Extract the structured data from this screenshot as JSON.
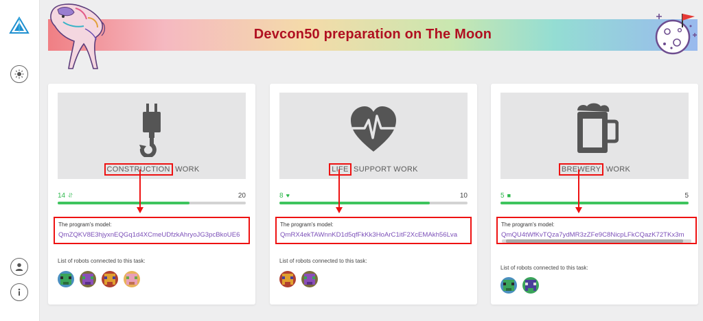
{
  "page": {
    "title": "Devcon50 preparation on The Moon"
  },
  "sidebar": {
    "logo_icon": "triangle-logo-icon",
    "theme_icon": "sun-icon",
    "profile_icon": "user-icon",
    "info_icon": "info-icon"
  },
  "common": {
    "model_label": "The program's model:",
    "robots_label": "List of robots connected to this task:"
  },
  "cards": [
    {
      "title_highlight": "CONSTRUCTION",
      "title_rest": " WORK",
      "icon": "crane-hook-icon",
      "unit_icon": "plug-icon",
      "current": "14",
      "total": "20",
      "progress": 0.7,
      "model": "QmZQKV8E3hjyxnEQGq1d4XCmeUDfzkAhryoJG3pcBkoUE6",
      "robots": [
        "robot-avatar",
        "robot-avatar",
        "robot-avatar",
        "robot-avatar"
      ]
    },
    {
      "title_highlight": "LIFE",
      "title_rest": " SUPPORT WORK",
      "icon": "heartbeat-icon",
      "unit_icon": "heart-icon",
      "current": "8",
      "total": "10",
      "progress": 0.8,
      "model": "QmRX4ekTAWnnKD1d5qfFkKk3HoArC1itF2XcEMAkh56Lva",
      "robots": [
        "robot-avatar",
        "robot-avatar"
      ]
    },
    {
      "title_highlight": "BREWERY",
      "title_rest": " WORK",
      "icon": "beer-mug-icon",
      "unit_icon": "beer-icon",
      "current": "5",
      "total": "5",
      "progress": 1.0,
      "model": "QmQU4tWfKvTQza7ydMR3zZFe9C8NicpLFkCQazK72TKx3m",
      "robots": [
        "robot-avatar",
        "robot-avatar"
      ]
    }
  ],
  "colors": {
    "accent_green": "#3ec45e",
    "title_red": "#b01021",
    "annotation_red": "#ee1111"
  }
}
